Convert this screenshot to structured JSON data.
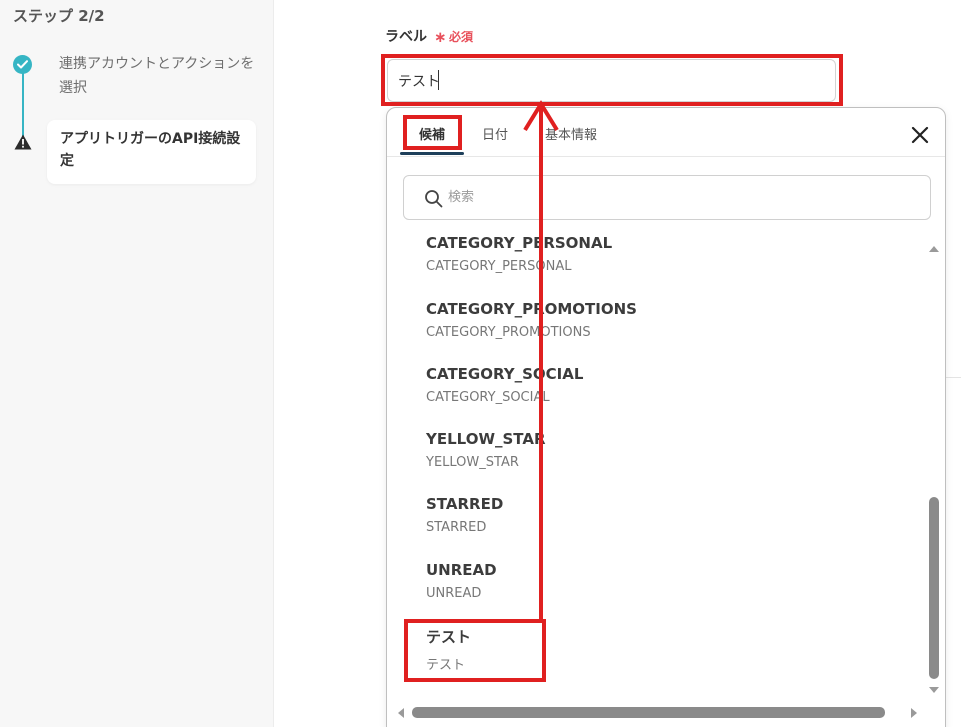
{
  "sidebar": {
    "step_heading": "ステップ 2/2",
    "steps": [
      {
        "label": "連携アカウントとアクションを選択",
        "status": "completed",
        "icon": "check-icon"
      },
      {
        "label": "アプリトリガーのAPI接続設定",
        "status": "warning",
        "icon": "warning-icon"
      }
    ],
    "accent_color": "#36b5c4"
  },
  "form": {
    "field_label": "ラベル",
    "required_mark": "∗",
    "required_text": "必須",
    "input_value": "テスト"
  },
  "panel": {
    "tabs": [
      {
        "label": "候補",
        "active": true
      },
      {
        "label": "日付",
        "active": false
      },
      {
        "label": "基本情報",
        "active": false
      }
    ],
    "close_icon": "close-icon",
    "search": {
      "placeholder": "検索",
      "icon": "search-icon"
    },
    "items": [
      {
        "title": "CATEGORY_PERSONAL",
        "sub": "CATEGORY_PERSONAL"
      },
      {
        "title": "CATEGORY_PROMOTIONS",
        "sub": "CATEGORY_PROMOTIONS"
      },
      {
        "title": "CATEGORY_SOCIAL",
        "sub": "CATEGORY_SOCIAL"
      },
      {
        "title": "YELLOW_STAR",
        "sub": "YELLOW_STAR"
      },
      {
        "title": "STARRED",
        "sub": "STARRED"
      },
      {
        "title": "UNREAD",
        "sub": "UNREAD"
      },
      {
        "title": "テスト",
        "sub": "テスト"
      }
    ]
  },
  "annotation_color": "#e02020"
}
